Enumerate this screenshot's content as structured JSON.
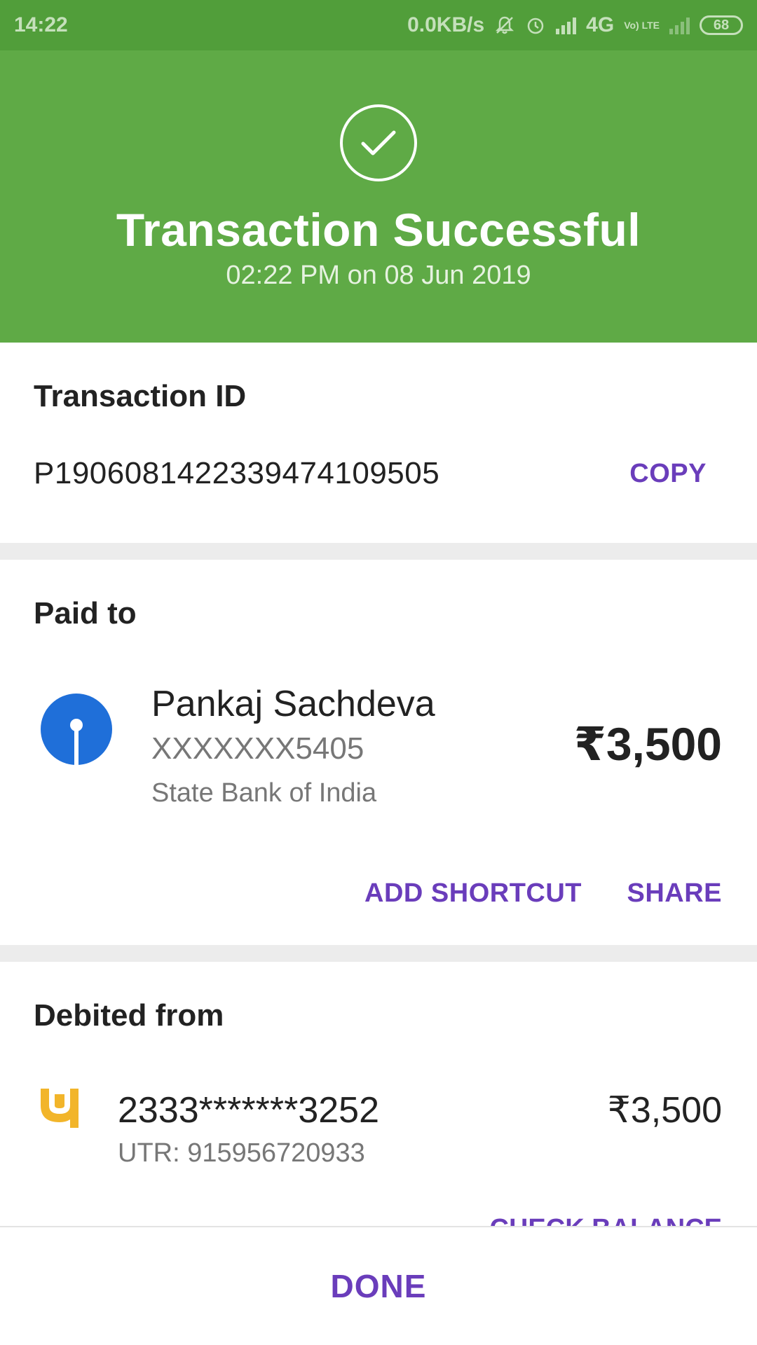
{
  "status_bar": {
    "time": "14:22",
    "network_speed": "0.0KB/s",
    "network_type": "4G",
    "volte_label": "Vo) LTE",
    "battery": "68"
  },
  "header": {
    "title": "Transaction Successful",
    "datetime": "02:22 PM on 08 Jun 2019",
    "icon": "check-circle-icon",
    "color": "#5faa46"
  },
  "transaction": {
    "label": "Transaction ID",
    "id": "P1906081422339474109505",
    "copy_label": "COPY"
  },
  "paid_to": {
    "label": "Paid to",
    "name": "Pankaj Sachdeva",
    "account": "XXXXXXX5405",
    "bank": "State Bank of India",
    "amount": "₹3,500",
    "add_shortcut_label": "ADD SHORTCUT",
    "share_label": "SHARE",
    "bank_logo": "sbi-logo-icon"
  },
  "debited_from": {
    "label": "Debited from",
    "account": "2333*******3252",
    "utr": "UTR: 915956720933",
    "amount": "₹3,500",
    "check_balance_label": "CHECK BALANCE",
    "bank_logo": "pnb-logo-icon"
  },
  "footer": {
    "done_label": "DONE"
  },
  "colors": {
    "accent": "#6a3dbb",
    "success": "#5faa46",
    "status_bar": "#519e3a"
  }
}
